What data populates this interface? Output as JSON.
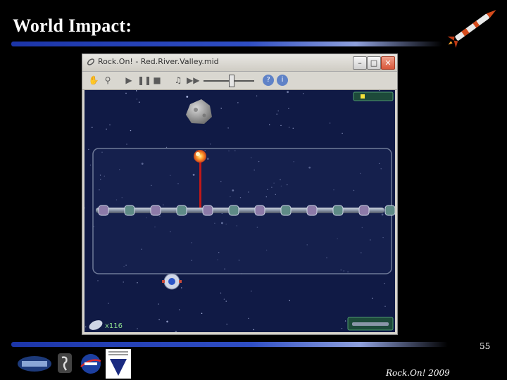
{
  "slide": {
    "title": "World Impact:",
    "slide_number": "55",
    "footer": "Rock.On! 2009"
  },
  "window": {
    "title": "Rock.On! - Red.River.Valley.mid",
    "controls": {
      "minimize": "–",
      "maximize": "□",
      "close": "✕"
    }
  },
  "toolbar": {
    "icons": [
      "hand-icon",
      "pin-icon",
      "play-icon",
      "pause-icon",
      "stop-icon",
      "music-note-icon",
      "fast-forward-icon",
      "volume-slider",
      "help-icon",
      "info-icon"
    ],
    "volume_level": 0.55
  },
  "game": {
    "lives_label": "x116",
    "colors": {
      "background": "#101a45",
      "laser": "#c01818",
      "rail": "#8a96a8",
      "arena_border": "#6f7a98"
    }
  },
  "logos": [
    "cosgc-logo",
    "shuttle-logo",
    "nasa-logo",
    "space-grant-logo"
  ]
}
